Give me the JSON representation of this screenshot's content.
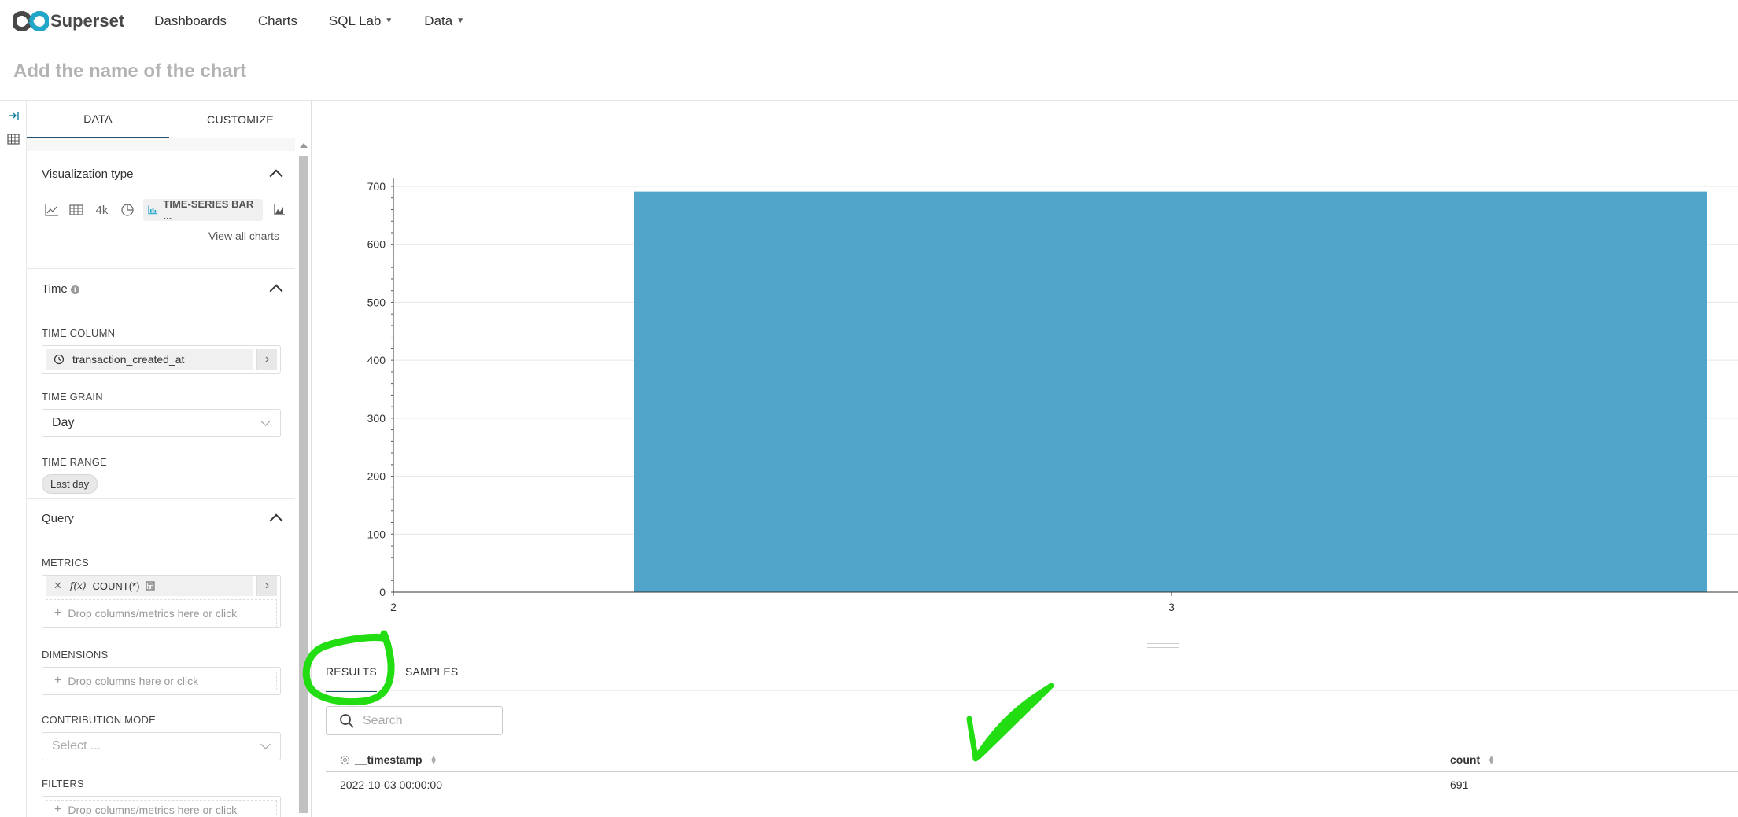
{
  "nav": {
    "brand": "Superset",
    "items": [
      {
        "label": "Dashboards"
      },
      {
        "label": "Charts"
      },
      {
        "label": "SQL Lab",
        "has_caret": true
      },
      {
        "label": "Data",
        "has_caret": true
      }
    ]
  },
  "chart_title_placeholder": "Add the name of the chart",
  "panel": {
    "tabs": [
      "DATA",
      "CUSTOMIZE"
    ],
    "active_tab": "DATA",
    "visualization": {
      "title": "Visualization type",
      "big_number_label": "4k",
      "active_type": "TIME-SERIES BAR ...",
      "view_all": "View all charts"
    },
    "time": {
      "title": "Time",
      "time_column_label": "TIME COLUMN",
      "time_column_value": "transaction_created_at",
      "time_grain_label": "TIME GRAIN",
      "time_grain_value": "Day",
      "time_range_label": "TIME RANGE",
      "time_range_value": "Last day"
    },
    "query": {
      "title": "Query",
      "metrics_label": "METRICS",
      "metric_value": "COUNT(*)",
      "metric_fx": "f(x)",
      "metrics_drop": "Drop columns/metrics here or click",
      "dimensions_label": "DIMENSIONS",
      "dimensions_drop": "Drop columns here or click",
      "contribution_label": "CONTRIBUTION MODE",
      "contribution_placeholder": "Select ...",
      "filters_label": "FILTERS",
      "filters_drop": "Drop columns/metrics here or click"
    }
  },
  "chart_data": {
    "type": "bar",
    "x": [
      3
    ],
    "x_tick_labels": [
      "2",
      "3"
    ],
    "values": [
      691
    ],
    "ylim": [
      0,
      700
    ],
    "y_ticks": [
      0,
      100,
      200,
      300,
      400,
      500,
      600,
      700
    ],
    "grid": true,
    "bar_color": "#51a5ca"
  },
  "results": {
    "tabs": [
      "RESULTS",
      "SAMPLES"
    ],
    "active_tab": "RESULTS",
    "search_placeholder": "Search",
    "columns": [
      "__timestamp",
      "count"
    ],
    "rows": [
      [
        "2022-10-03 00:00:00",
        "691"
      ]
    ]
  },
  "colors": {
    "accent": "#20516c",
    "annotation_green": "#22dd11"
  }
}
